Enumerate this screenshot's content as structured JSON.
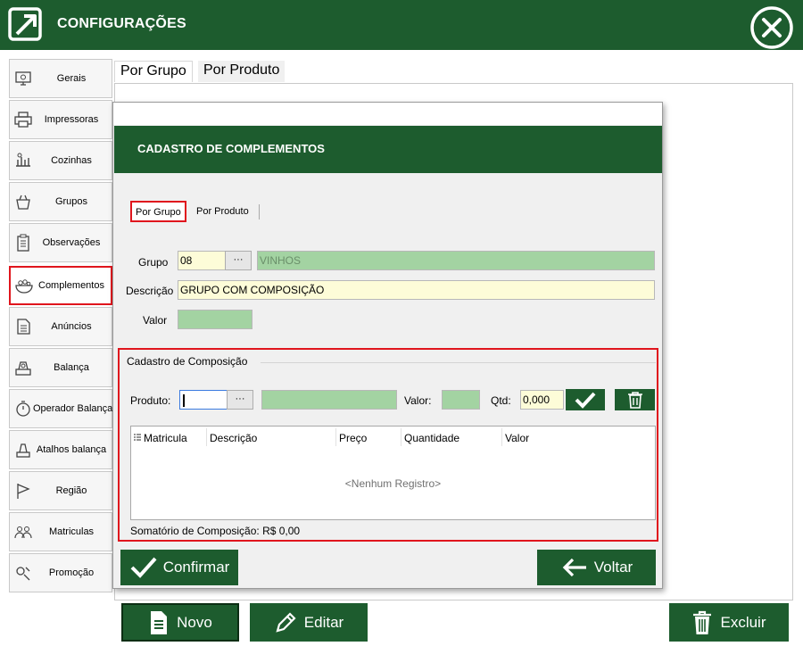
{
  "window": {
    "title": "CONFIGURAÇÕES"
  },
  "sidebar": {
    "items": [
      {
        "label": "Gerais",
        "icon": "monitor-icon"
      },
      {
        "label": "Impressoras",
        "icon": "printer-icon"
      },
      {
        "label": "Cozinhas",
        "icon": "kitchen-icon"
      },
      {
        "label": "Grupos",
        "icon": "basket-icon"
      },
      {
        "label": "Observações",
        "icon": "clipboard-icon"
      },
      {
        "label": "Complementos",
        "icon": "bowl-icon"
      },
      {
        "label": "Anúncios",
        "icon": "document-icon"
      },
      {
        "label": "Balança",
        "icon": "scale-icon"
      },
      {
        "label": "Operador  Balança",
        "icon": "timer-icon"
      },
      {
        "label": "Atalhos balança",
        "icon": "scale-shortcut-icon"
      },
      {
        "label": "Região",
        "icon": "flag-icon"
      },
      {
        "label": "Matriculas",
        "icon": "people-icon"
      },
      {
        "label": "Promoção",
        "icon": "promo-icon"
      }
    ],
    "active": "Complementos"
  },
  "outer_tabs": [
    "Por Grupo",
    "Por Produto"
  ],
  "bottom_buttons": {
    "new": "Novo",
    "edit": "Editar",
    "delete": "Excluir"
  },
  "dialog": {
    "title": "CADASTRO DE COMPLEMENTOS",
    "tabs": [
      "Por Grupo",
      "Por Produto"
    ],
    "form": {
      "grupo_label": "Grupo",
      "grupo_code": "08",
      "grupo_ellipsis": "···",
      "grupo_name": "VINHOS",
      "descricao_label": "Descrição",
      "descricao_value": "GRUPO COM COMPOSIÇÃO",
      "valor_label": "Valor",
      "valor_value": ""
    },
    "composition": {
      "title": "Cadastro de Composição",
      "produto_label": "Produto:",
      "produto_ellipsis": "···",
      "valor_label": "Valor:",
      "qtd_label": "Qtd:",
      "qtd_value": "0,000",
      "columns": [
        "Matricula",
        "Descrição",
        "Preço",
        "Quantidade",
        "Valor"
      ],
      "empty_text": "<Nenhum Registro>",
      "total": "Somatório de Composição: R$ 0,00"
    },
    "buttons": {
      "confirm": "Confirmar",
      "back": "Voltar"
    }
  },
  "colors": {
    "brand_green": "#1d5c2e",
    "field_green": "#a3d3a2",
    "field_yellow": "#fdfcd8",
    "highlight_red": "#e0151d"
  }
}
